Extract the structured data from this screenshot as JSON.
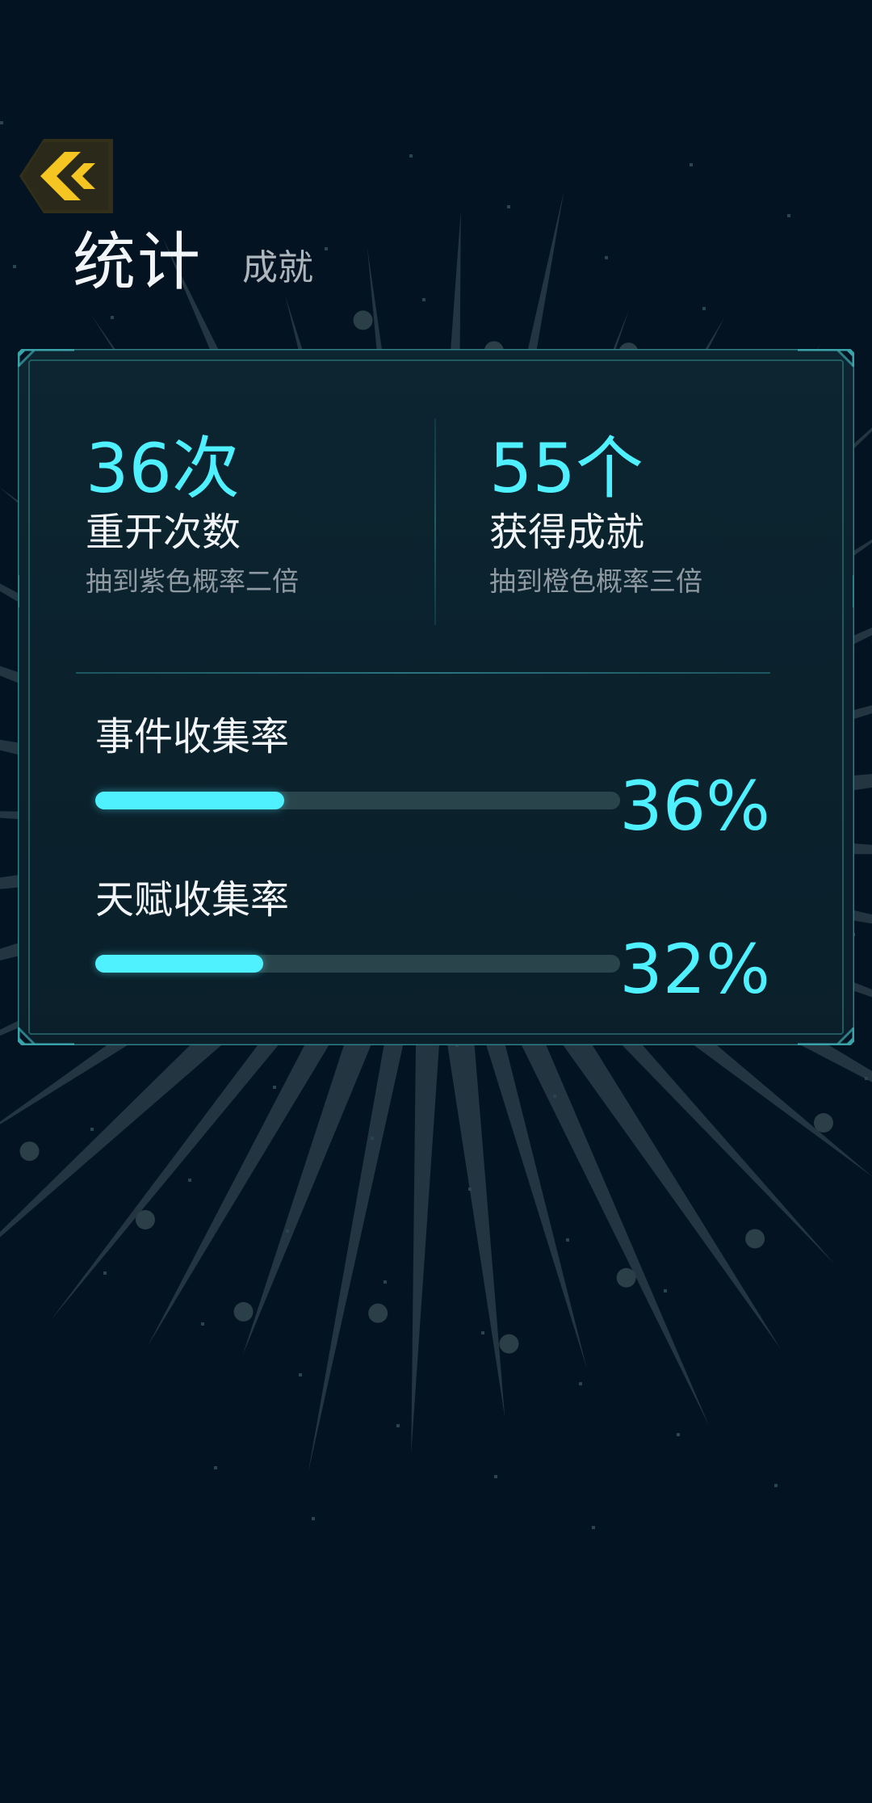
{
  "colors": {
    "background": "#041321",
    "accent": "#4ff0ff",
    "back_button": "#f5c522",
    "panel_border": "#2d7f85",
    "bar_track": "#29454b"
  },
  "header": {
    "back_icon": "chevron-left-double-icon",
    "tab_active": "统计",
    "tab_inactive": "成就"
  },
  "stats": {
    "restarts": {
      "value": "36次",
      "label": "重开次数",
      "note": "抽到紫色概率二倍"
    },
    "achievements": {
      "value": "55个",
      "label": "获得成就",
      "note": "抽到橙色概率三倍"
    }
  },
  "rates": {
    "events": {
      "label": "事件收集率",
      "percent_text": "36%",
      "fraction": 0.36
    },
    "talents": {
      "label": "天赋收集率",
      "percent_text": "32%",
      "fraction": 0.32
    }
  }
}
